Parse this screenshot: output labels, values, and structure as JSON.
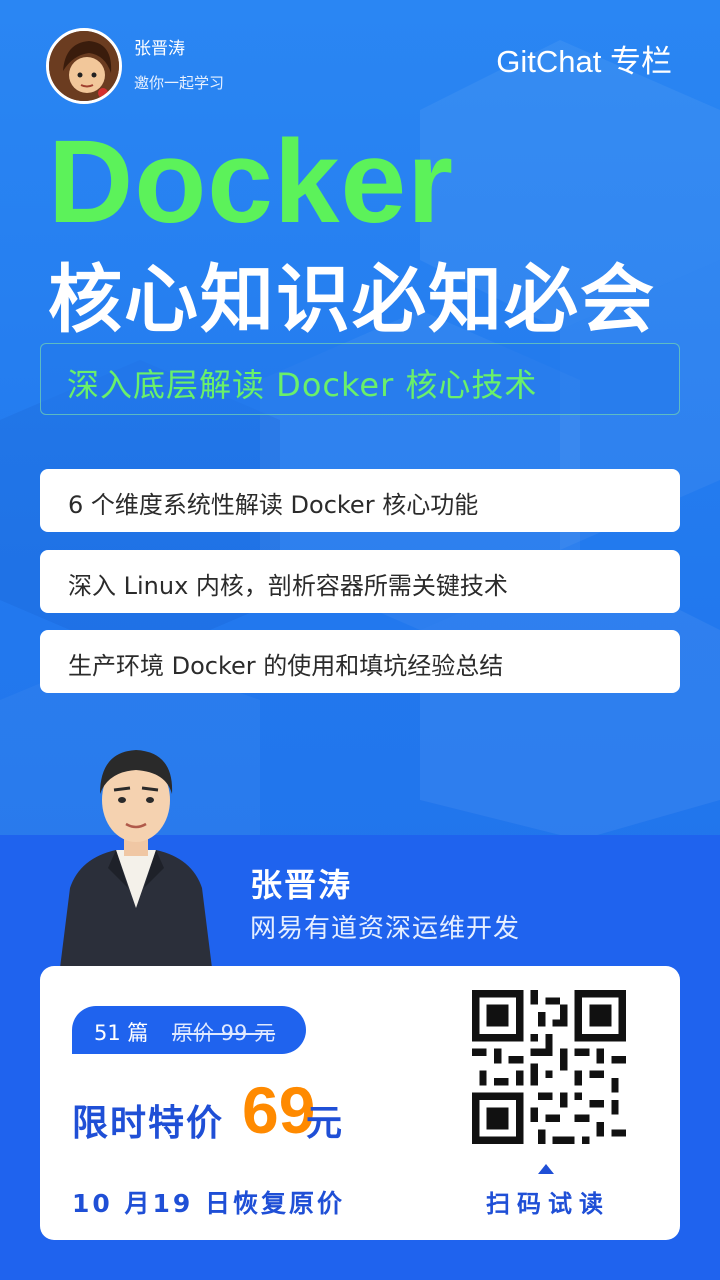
{
  "header": {
    "author_small": "张晋涛",
    "invite": "邀你一起学习",
    "brand": "GitChat 专栏"
  },
  "title": {
    "english": "Docker",
    "chinese": "核心知识必知必会",
    "subtitle": "深入底层解读 Docker 核心技术"
  },
  "features": [
    "6 个维度系统性解读 Docker 核心功能",
    "深入 Linux 内核，剖析容器所需关键技术",
    "生产环境 Docker 的使用和填坑经验总结"
  ],
  "author": {
    "name": "张晋涛",
    "title": "网易有道资深运维开发"
  },
  "pricing": {
    "count": "51 篇",
    "original": "原价 99 元",
    "deal_label": "限时特价",
    "deal_price": "69",
    "deal_unit": "元",
    "restore_date": "10 月19 日恢复原价"
  },
  "qr": {
    "label": "扫码试读"
  },
  "colors": {
    "primary_blue": "#1f63ee",
    "accent_green": "#5cf25a",
    "price_orange": "#ff8a00"
  }
}
